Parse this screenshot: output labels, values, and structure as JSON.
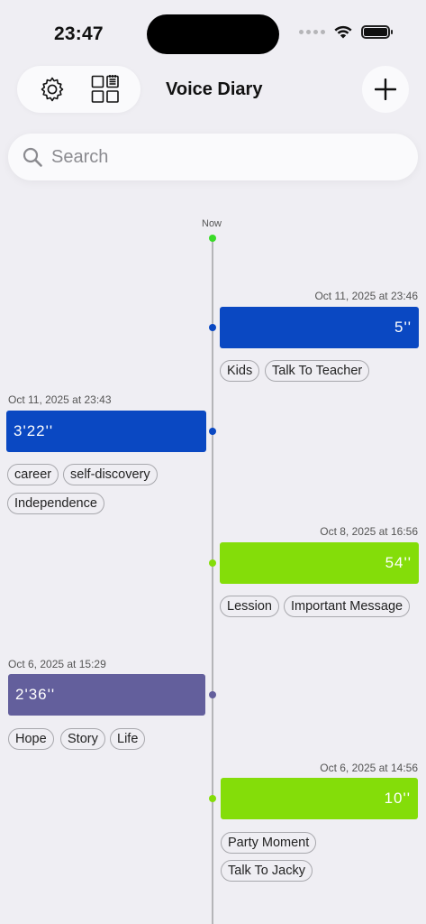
{
  "status_bar": {
    "time": "23:47"
  },
  "header": {
    "title": "Voice Diary",
    "settings_icon": "gear-icon",
    "layout_icon": "grid-layout-icon",
    "add_icon": "plus-icon"
  },
  "search": {
    "placeholder": "Search",
    "value": ""
  },
  "timeline": {
    "now_label": "Now",
    "entries": [
      {
        "date": "Oct 11, 2025 at 23:46",
        "duration": "5''",
        "color": "#0a48c2",
        "side": "right",
        "tags": [
          "Kids",
          "Talk To Teacher"
        ]
      },
      {
        "date": "Oct 11, 2025 at 23:43",
        "duration": "3'22''",
        "color": "#0a48c2",
        "side": "left",
        "tags": [
          "career",
          "self-discovery",
          "Independence"
        ]
      },
      {
        "date": "Oct 8, 2025 at 16:56",
        "duration": "54''",
        "color": "#84dd09",
        "side": "right",
        "tags": [
          "Lession",
          "Important Message"
        ]
      },
      {
        "date": "Oct 6, 2025 at 15:29",
        "duration": "2'36''",
        "color": "#635f9c",
        "side": "left",
        "tags": [
          "Hope",
          "Story",
          "Life"
        ]
      },
      {
        "date": "Oct 6, 2025 at 14:56",
        "duration": "10''",
        "color": "#84dd09",
        "side": "right",
        "tags": [
          "Party Moment",
          "Talk To Jacky"
        ]
      }
    ]
  }
}
